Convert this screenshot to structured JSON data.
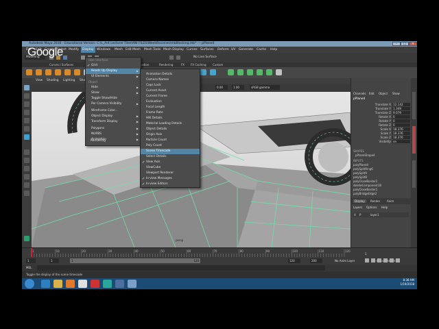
{
  "window": {
    "title": "Autodesk Maya 2016 - Educational Version: C:\\L_Ant Lecturer Files\\ANI FILES\\Week6\\scenes\\mkBlocking.mb* --- pPlane4"
  },
  "watermark": "Google",
  "menubar": [
    "File",
    "Edit",
    "Create",
    "Select",
    "Modify",
    "Display",
    "Windows",
    "Mesh",
    "Edit Mesh",
    "Mesh Tools",
    "Mesh Display",
    "Curves",
    "Surfaces",
    "Deform",
    "UV",
    "Generate",
    "Cache",
    "Help"
  ],
  "status": {
    "mode": "Modeling",
    "no_live_surface": "No Live Surface"
  },
  "shelf_tabs": [
    "Curves / Surfaces",
    "Animation",
    "Rendering",
    "FX",
    "FX Caching",
    "Custom"
  ],
  "viewport": {
    "menu": [
      "View",
      "Shading",
      "Lighting",
      "Show",
      "Renderer",
      "Panels"
    ],
    "field1": "0.00",
    "field2": "1.00",
    "colorspace": "sRGB gamma",
    "label": "persp"
  },
  "display_menu": {
    "section": "User Interface",
    "items": [
      "Grid",
      "Heads Up Display",
      "UI Elements"
    ],
    "section2": "Object",
    "items2": [
      "Hide",
      "Show",
      "Toggle Show/Hide",
      "Per Camera Visibility",
      "Wireframe Color...",
      "Object Display",
      "Transform Display",
      "Polygons",
      "NURBS",
      "Animation",
      "Rendering"
    ]
  },
  "hud_menu": {
    "items": [
      {
        "label": "Animation Details",
        "checked": false
      },
      {
        "label": "Camera Names",
        "checked": false
      },
      {
        "label": "Caps Lock",
        "checked": false
      },
      {
        "label": "Current Asset",
        "checked": false
      },
      {
        "label": "Current Frame",
        "checked": false
      },
      {
        "label": "Evaluation",
        "checked": false
      },
      {
        "label": "Focal Length",
        "checked": false
      },
      {
        "label": "Frame Rate",
        "checked": false
      },
      {
        "label": "HIK Details",
        "checked": false
      },
      {
        "label": "Material Loading Details",
        "checked": false
      },
      {
        "label": "Object Details",
        "checked": false
      },
      {
        "label": "Origin Axis",
        "checked": false
      },
      {
        "label": "Particle Count",
        "checked": false
      },
      {
        "label": "Poly Count",
        "checked": false
      },
      {
        "label": "Scene Timecode",
        "checked": false
      },
      {
        "label": "Select Details",
        "checked": false
      },
      {
        "label": "View Axis",
        "checked": true
      },
      {
        "label": "ViewCube",
        "checked": false
      },
      {
        "label": "Viewport Renderer",
        "checked": false
      },
      {
        "label": "In-view Messages",
        "checked": true
      },
      {
        "label": "In-view Editors",
        "checked": true
      }
    ]
  },
  "channel_box": {
    "tabs": [
      "Channels",
      "Edit",
      "Object",
      "Show"
    ],
    "object": "pPlane4",
    "channels": [
      {
        "name": "Translate X",
        "value": "12.142"
      },
      {
        "name": "Translate Y",
        "value": "1.349"
      },
      {
        "name": "Translate Z",
        "value": "9.079"
      },
      {
        "name": "Rotate X",
        "value": "0"
      },
      {
        "name": "Rotate Y",
        "value": "0"
      },
      {
        "name": "Rotate Z",
        "value": "0"
      },
      {
        "name": "Scale X",
        "value": "18.376"
      },
      {
        "name": "Scale Y",
        "value": "18.376"
      },
      {
        "name": "Scale Z",
        "value": "18.376"
      },
      {
        "name": "Visibility",
        "value": "on"
      }
    ],
    "shapes_label": "SHAPES",
    "shape": "pPlaneShape4",
    "inputs_label": "INPUTS",
    "inputs": [
      "polyPlane4",
      "polySplitRing6",
      "polySplit9",
      "polySplit8",
      "polyCloseBorder2",
      "deleteComponent18",
      "polyCloseBorder1",
      "polyBridgeEdge2"
    ],
    "layer_tabs": [
      "Display",
      "Render",
      "Anim"
    ],
    "layer_menu": [
      "Layers",
      "Options",
      "Help"
    ],
    "layer_row": {
      "v": "V",
      "p": "P",
      "name": "layer1"
    }
  },
  "timeline": {
    "ticks": [
      "1",
      "10",
      "20",
      "30",
      "40",
      "50",
      "60",
      "70",
      "80",
      "90",
      "100",
      "110",
      "120"
    ],
    "current_frame": "1"
  },
  "range": {
    "start": "1",
    "inner_start": "1",
    "handle_start": "1",
    "handle_end": "120",
    "inner_end": "120",
    "end": "200",
    "anim_layer": "No Anim Layer",
    "char_set": "No Character Set"
  },
  "mel_label": "MEL",
  "help_line": "Toggle the display of the scene timecode",
  "tray": {
    "time": "8:38 AM",
    "date": "1/19/2018"
  },
  "colors": {
    "menu_highlight": "#5285a6",
    "grid_green": "#6fe0a8",
    "taskbar": "#1c4c75"
  }
}
